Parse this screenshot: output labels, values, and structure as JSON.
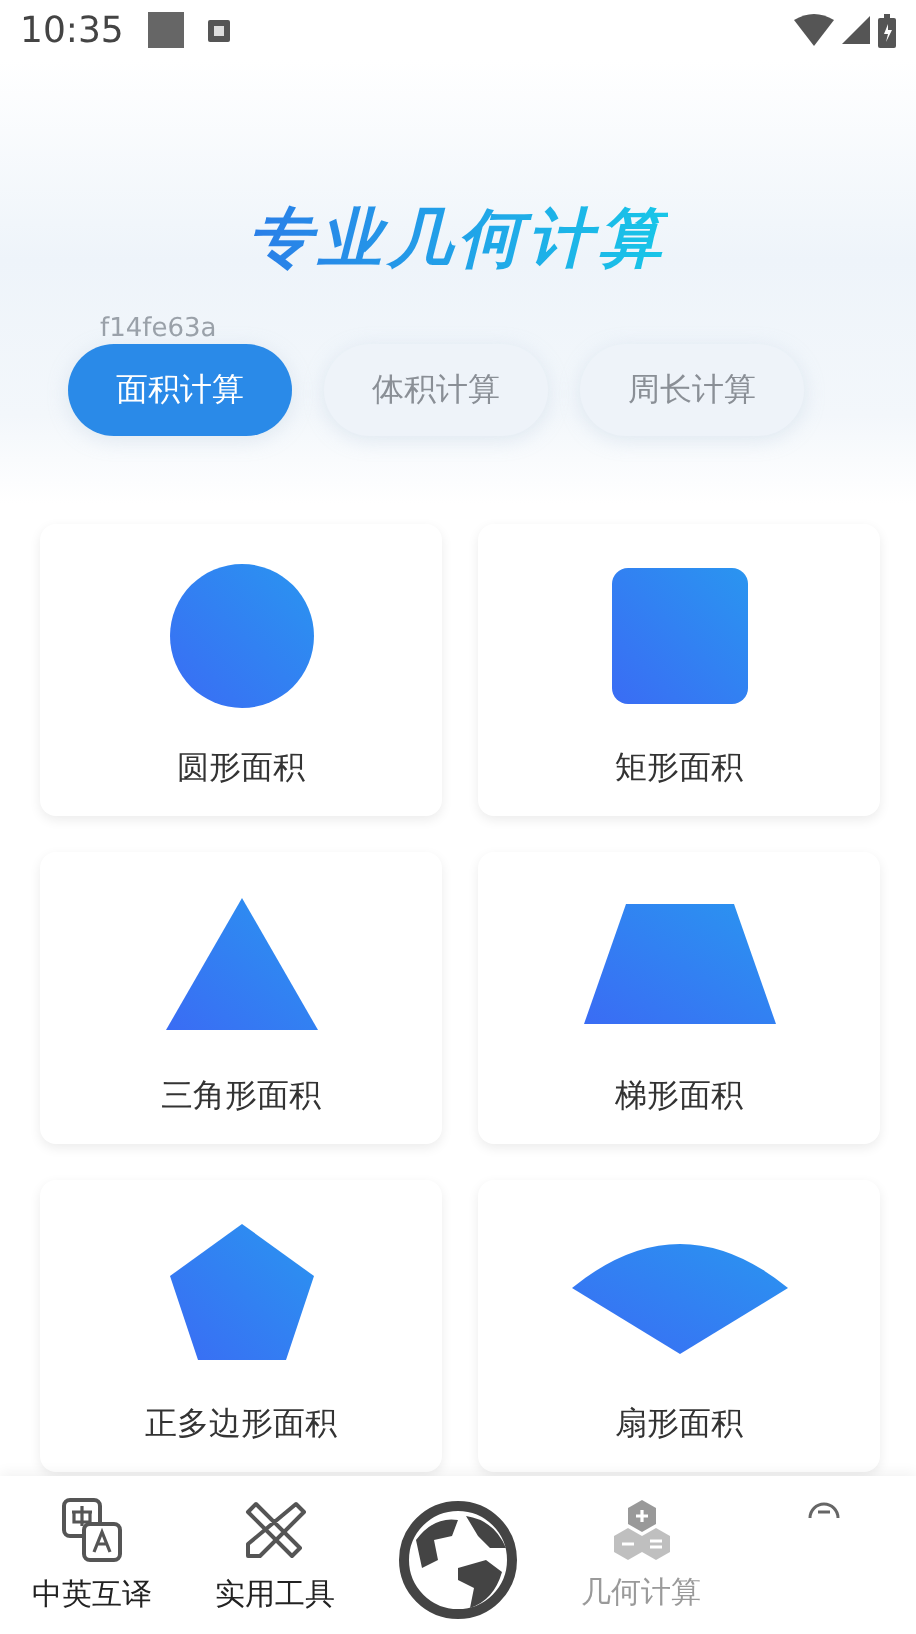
{
  "status_bar": {
    "time": "10:35"
  },
  "header": {
    "title": "专业几何计算",
    "code": "f14fe63a"
  },
  "tabs": [
    {
      "label": "面积计算",
      "selected": true
    },
    {
      "label": "体积计算",
      "selected": false
    },
    {
      "label": "周长计算",
      "selected": false
    }
  ],
  "shapes": [
    {
      "kind": "circle",
      "label": "圆形面积"
    },
    {
      "kind": "square",
      "label": "矩形面积"
    },
    {
      "kind": "triangle",
      "label": "三角形面积"
    },
    {
      "kind": "trapezoid",
      "label": "梯形面积"
    },
    {
      "kind": "pentagon",
      "label": "正多边形面积"
    },
    {
      "kind": "sector",
      "label": "扇形面积"
    }
  ],
  "bottom_nav": [
    {
      "kind": "translate",
      "label": "中英互译",
      "selected": false
    },
    {
      "kind": "tools",
      "label": "实用工具",
      "selected": false
    },
    {
      "kind": "globe"
    },
    {
      "kind": "geometry",
      "label": "几何计算",
      "selected": true
    },
    {
      "kind": "partial"
    }
  ]
}
